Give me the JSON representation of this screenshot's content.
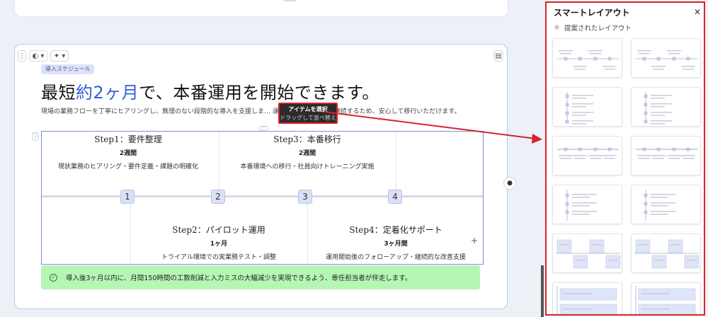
{
  "slide": {
    "badge": "導入スケジュール",
    "headline_pre": "最短",
    "headline_hl": "約2ヶ月",
    "headline_post": "で、本番運用を開始できます。",
    "description": "現場の業務フローを丁寧にヒアリングし、無理のない段階的な導入を支援しま… 運用開始後も3ヶ月間継続するため、安心して移行いただけます。",
    "callout": "導入後3ヶ月以内に、月間150時間の工数削減と入力ミスの大幅減少を実現できるよう、専任担当者が伴走します。"
  },
  "steps": [
    {
      "marker": "1",
      "title": "Step1：要件整理",
      "duration": "2週間",
      "detail": "現状業務のヒアリング・要件定義・課題の明確化"
    },
    {
      "marker": "2",
      "title": "Step2：パイロット運用",
      "duration": "1ヶ月",
      "detail": "トライアル環境での実業務テスト・調整"
    },
    {
      "marker": "3",
      "title": "Step3：本番移行",
      "duration": "2週間",
      "detail": "本番環境への移行・社員向けトレーニング実施"
    },
    {
      "marker": "4",
      "title": "Step4：定着化サポート",
      "duration": "3ヶ月間",
      "detail": "運用開始後のフォローアップ・継続的な改善支援"
    }
  ],
  "tooltip": {
    "line1": "アイテムを選択",
    "line2": "ドラッグして並べ替え"
  },
  "panel": {
    "title": "スマートレイアウト",
    "subtitle": "提案されたレイアウト",
    "layouts": [
      "timeline-horizontal-top",
      "timeline-horizontal-alt",
      "timeline-vertical-left",
      "timeline-vertical-center",
      "timeline-line-top",
      "timeline-line-alt",
      "timeline-vertical-list",
      "timeline-vertical-list-alt",
      "boxes-row",
      "boxes-stagger",
      "cards-stack",
      "cards-stack-alt"
    ]
  },
  "colors": {
    "accent": "#2f60d8",
    "highlight_border": "#d8232a",
    "callout_bg": "#b5f6b3",
    "marker_bg": "#d9e0f7"
  }
}
